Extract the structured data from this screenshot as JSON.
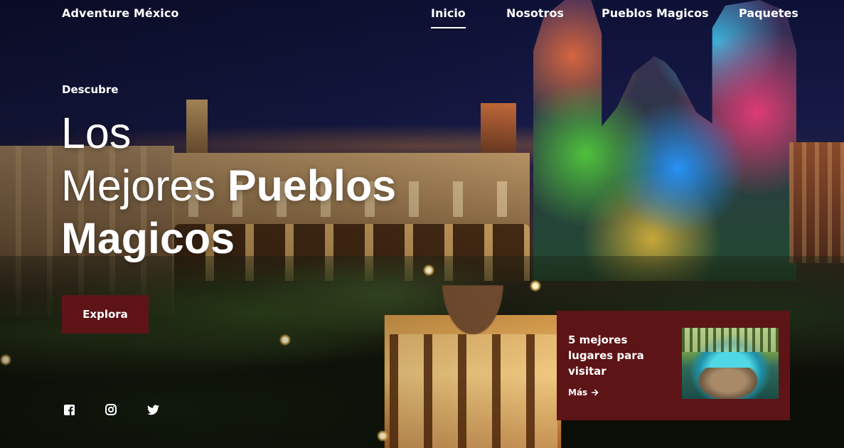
{
  "header": {
    "brand": "Adventure México",
    "nav": [
      {
        "label": "Inicio",
        "active": true
      },
      {
        "label": "Nosotros",
        "active": false
      },
      {
        "label": "Pueblos Magicos",
        "active": false
      },
      {
        "label": "Paquetes",
        "active": false
      }
    ]
  },
  "hero": {
    "eyebrow": "Descubre",
    "title_line1": "Los",
    "title_line2_light": "Mejores",
    "title_line2_bold": "Pueblos",
    "title_line3_bold": "Magicos",
    "cta_label": "Explora"
  },
  "social": [
    {
      "icon": "facebook-icon"
    },
    {
      "icon": "instagram-icon"
    },
    {
      "icon": "twitter-icon"
    }
  ],
  "feature_card": {
    "title": "5 mejores lugares para visitar",
    "more_label": "Más",
    "more_icon": "arrow-right-icon",
    "image": "cenote-photo"
  },
  "colors": {
    "accent": "#5e1417",
    "text": "#ffffff"
  }
}
